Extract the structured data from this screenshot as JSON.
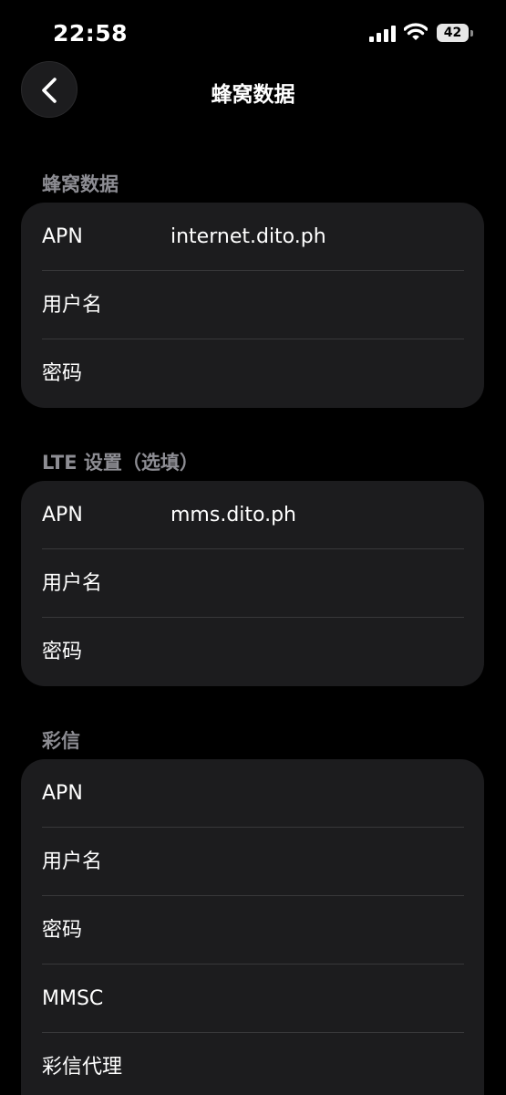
{
  "status_bar": {
    "time": "22:58",
    "battery_level": "42",
    "icons": [
      "signal-icon",
      "wifi-icon",
      "battery-icon"
    ]
  },
  "nav": {
    "title": "蜂窝数据",
    "back_icon": "chevron-left-icon"
  },
  "sections": [
    {
      "header": "蜂窝数据",
      "rows": [
        {
          "label": "APN",
          "value": "internet.dito.ph"
        },
        {
          "label": "用户名",
          "value": ""
        },
        {
          "label": "密码",
          "value": ""
        }
      ]
    },
    {
      "header": "LTE 设置（选填）",
      "rows": [
        {
          "label": "APN",
          "value": "mms.dito.ph"
        },
        {
          "label": "用户名",
          "value": ""
        },
        {
          "label": "密码",
          "value": ""
        }
      ]
    },
    {
      "header": "彩信",
      "rows": [
        {
          "label": "APN",
          "value": ""
        },
        {
          "label": "用户名",
          "value": ""
        },
        {
          "label": "密码",
          "value": ""
        },
        {
          "label": "MMSC",
          "value": ""
        },
        {
          "label": "彩信代理",
          "value": ""
        }
      ]
    }
  ]
}
